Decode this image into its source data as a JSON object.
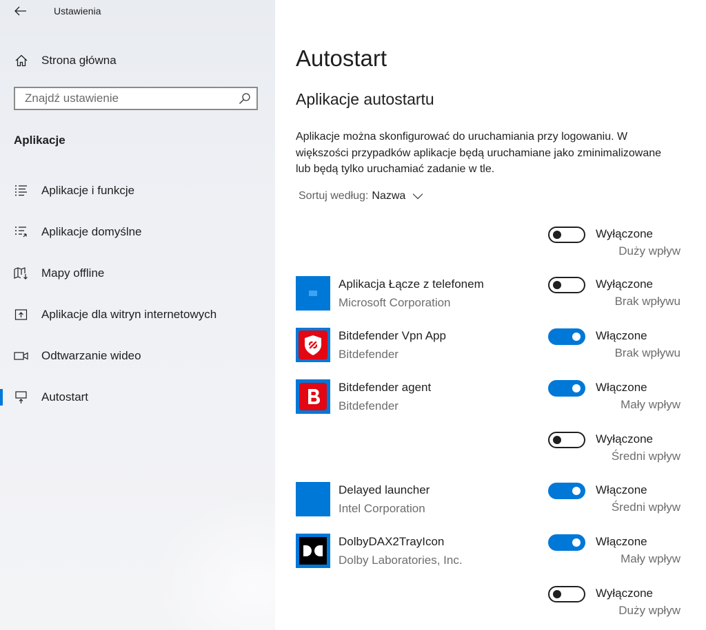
{
  "window": {
    "title": "Ustawienia",
    "back_icon": "arrow-left-icon"
  },
  "sidebar": {
    "home": {
      "label": "Strona główna",
      "icon": "home-icon"
    },
    "search": {
      "placeholder": "Znajdź ustawienie",
      "value": "",
      "icon": "search-icon"
    },
    "section_title": "Aplikacje",
    "items": [
      {
        "label": "Aplikacje i funkcje",
        "icon": "apps-list-icon",
        "active": false
      },
      {
        "label": "Aplikacje domyślne",
        "icon": "default-apps-icon",
        "active": false
      },
      {
        "label": "Mapy offline",
        "icon": "map-download-icon",
        "active": false
      },
      {
        "label": "Aplikacje dla witryn internetowych",
        "icon": "website-app-icon",
        "active": false
      },
      {
        "label": "Odtwarzanie wideo",
        "icon": "video-camera-icon",
        "active": false
      },
      {
        "label": "Autostart",
        "icon": "startup-icon",
        "active": true
      }
    ],
    "accent_color": "#0078d7"
  },
  "main": {
    "title": "Autostart",
    "subtitle": "Aplikacje autostartu",
    "description": "Aplikacje można skonfigurować do uruchamiania przy logowaniu. W większości przypadków aplikacje będą uruchamiane jako zminimalizowane lub będą tylko uruchamiać zadanie w tle.",
    "sort": {
      "label": "Sortuj według:",
      "value": "Nazwa"
    },
    "apps": [
      {
        "name": "",
        "publisher": "",
        "icon": "",
        "enabled": false,
        "state": "Wyłączone",
        "impact": "Duży wpływ"
      },
      {
        "name": "Aplikacja Łącze z telefonem",
        "publisher": "Microsoft Corporation",
        "icon": "phone-link-icon",
        "enabled": false,
        "state": "Wyłączone",
        "impact": "Brak wpływu"
      },
      {
        "name": "Bitdefender Vpn App",
        "publisher": "Bitdefender",
        "icon": "bitdefender-vpn-icon",
        "enabled": true,
        "state": "Włączone",
        "impact": "Brak wpływu"
      },
      {
        "name": "Bitdefender agent",
        "publisher": "Bitdefender",
        "icon": "bitdefender-agent-icon",
        "enabled": true,
        "state": "Włączone",
        "impact": "Mały wpływ"
      },
      {
        "name": "",
        "publisher": "",
        "icon": "",
        "enabled": false,
        "state": "Wyłączone",
        "impact": "Średni wpływ"
      },
      {
        "name": "Delayed launcher",
        "publisher": "Intel Corporation",
        "icon": "intel-launcher-icon",
        "enabled": true,
        "state": "Włączone",
        "impact": "Średni wpływ"
      },
      {
        "name": "DolbyDAX2TrayIcon",
        "publisher": "Dolby Laboratories, Inc.",
        "icon": "dolby-icon",
        "enabled": true,
        "state": "Włączone",
        "impact": "Mały wpływ"
      },
      {
        "name": "",
        "publisher": "",
        "icon": "",
        "enabled": false,
        "state": "Wyłączone",
        "impact": "Duży wpływ"
      }
    ],
    "colors": {
      "toggle_on": "#0078d7",
      "secondary_text": "#6d6d6d"
    }
  }
}
